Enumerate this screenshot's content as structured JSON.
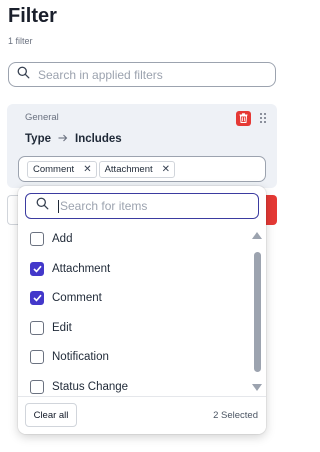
{
  "header": {
    "title": "Filter",
    "subtitle": "1 filter"
  },
  "applied_search": {
    "placeholder": "Search in applied filters",
    "icon": "search-icon"
  },
  "filter_card": {
    "group_label": "General",
    "field": "Type",
    "operator": "Includes",
    "chips": [
      {
        "label": "Comment"
      },
      {
        "label": "Attachment"
      }
    ],
    "colors": {
      "delete": "#e53935",
      "background": "#eef1f6"
    }
  },
  "dropdown": {
    "search_placeholder": "Search for items",
    "options": [
      {
        "label": "Add",
        "checked": false
      },
      {
        "label": "Attachment",
        "checked": true
      },
      {
        "label": "Comment",
        "checked": true
      },
      {
        "label": "Edit",
        "checked": false
      },
      {
        "label": "Notification",
        "checked": false
      },
      {
        "label": "Status Change",
        "checked": false
      }
    ],
    "clear_label": "Clear all",
    "selected_count": "2 Selected",
    "colors": {
      "checkbox_checked": "#4338ca",
      "search_focus": "#3b3ba0"
    }
  }
}
